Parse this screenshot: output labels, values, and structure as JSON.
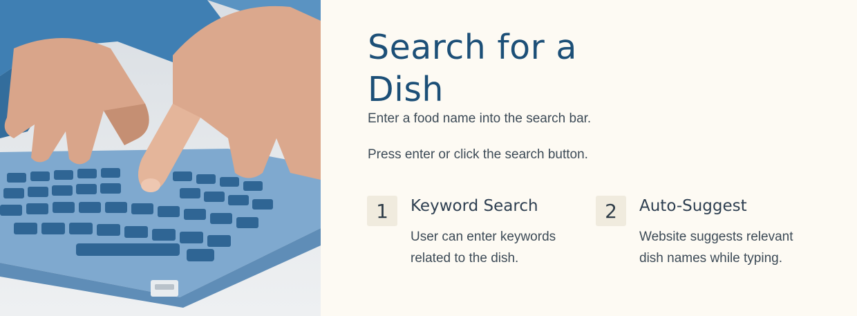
{
  "slide": {
    "title": "Search for a Dish",
    "lines": [
      "Enter a food name into the search bar.",
      "Press enter or click the search button."
    ],
    "features": [
      {
        "number": "1",
        "title": "Keyword Search",
        "description": "User can enter keywords related to the dish."
      },
      {
        "number": "2",
        "title": "Auto-Suggest",
        "description": "Website suggests relevant dish names while typing."
      }
    ]
  },
  "photo": {
    "subject": "hands-typing-on-keyboard",
    "colors": {
      "sleeve": "#3f7fb3",
      "keyboard": "#7fa9cf",
      "keys": "#2f6594",
      "skin": "#d9a58a"
    }
  },
  "colors": {
    "background": "#fdfaf3",
    "title": "#1c4f77",
    "body_text": "#3c4a56",
    "number_box": "#f0ebde"
  }
}
